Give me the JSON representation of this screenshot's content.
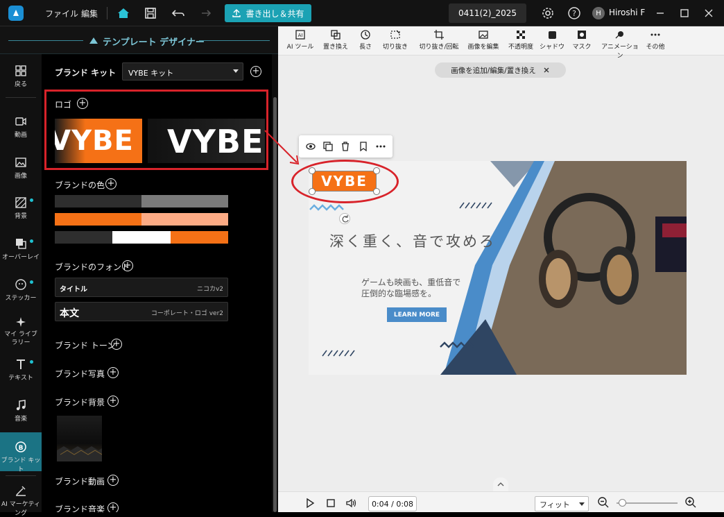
{
  "titlebar": {
    "menu_file": "ファイル",
    "menu_edit": "編集",
    "export_label": "書き出し＆共有",
    "project_name": "0411(2)_2025",
    "avatar_initial": "H",
    "username": "Hiroshi F"
  },
  "designer": {
    "title": "テンプレート デザイナー"
  },
  "iconbar": {
    "items": [
      {
        "label": "戻る",
        "icon": "grid-icon"
      },
      {
        "label": "動画",
        "icon": "video-icon"
      },
      {
        "label": "画像",
        "icon": "image-icon"
      },
      {
        "label": "背景",
        "icon": "background-icon"
      },
      {
        "label": "オーバーレイ",
        "icon": "overlay-icon"
      },
      {
        "label": "ステッカー",
        "icon": "sticker-icon"
      },
      {
        "label": "マイ ライブラリー",
        "icon": "library-icon"
      },
      {
        "label": "テキスト",
        "icon": "text-icon"
      },
      {
        "label": "音楽",
        "icon": "music-icon"
      },
      {
        "label": "ブランド キット",
        "icon": "brand-kit-icon"
      },
      {
        "label": "AI マーケティング",
        "icon": "ai-marketing-icon"
      }
    ]
  },
  "panel": {
    "brand_kit_label": "ブランド キット",
    "kit_value": "VYBE キット",
    "logo_label": "ロゴ",
    "logo_text": "VYBE",
    "colors_label": "ブランドの色",
    "colors": {
      "row1": [
        "#2e2e2e",
        "#7a7a7a"
      ],
      "row2": [
        "#f57116",
        "#fcab85"
      ],
      "row3": [
        "#2e2e2e",
        "#ffffff",
        "#f57116"
      ]
    },
    "fonts_label": "ブランドのフォント",
    "font_title_label": "タイトル",
    "font_title_name": "ニコカv2",
    "font_body_label": "本文",
    "font_body_name": "コーポレート・ロゴ ver2",
    "tone_label": "ブランド トーン",
    "photo_label": "ブランド写真",
    "bg_label": "ブランド背景",
    "video_label": "ブランド動画",
    "audio_label": "ブランド音楽"
  },
  "toolbar": {
    "items": [
      {
        "label": "AI ツール",
        "icon": "ai-tool-icon"
      },
      {
        "label": "置き換え",
        "icon": "replace-icon"
      },
      {
        "label": "長さ",
        "icon": "duration-icon"
      },
      {
        "label": "切り抜き",
        "icon": "cutout-icon"
      },
      {
        "label": "切り抜き/回転",
        "icon": "crop-icon"
      },
      {
        "label": "画像を編集",
        "icon": "edit-image-icon"
      },
      {
        "label": "不透明度",
        "icon": "opacity-icon"
      },
      {
        "label": "シャドウ",
        "icon": "shadow-icon"
      },
      {
        "label": "マスク",
        "icon": "mask-icon"
      },
      {
        "label": "アニメーション",
        "icon": "animation-icon"
      },
      {
        "label": "その他",
        "icon": "more-icon"
      }
    ]
  },
  "hint": {
    "text": "画像を追加/編集/置き換え"
  },
  "canvas": {
    "logo_text": "VYBE",
    "headline": "深く重く、音で攻めろ",
    "body_line1": "ゲームも映画も、重低音で",
    "body_line2": "圧倒的な臨場感を。",
    "cta_label": "LEARN MORE",
    "accent": "#f57116",
    "blue": "#4a8cc9",
    "navy": "#2f4562"
  },
  "playbar": {
    "time": "0:04 / 0:08",
    "fit_label": "フィット",
    "zoom_level": 0.05
  }
}
